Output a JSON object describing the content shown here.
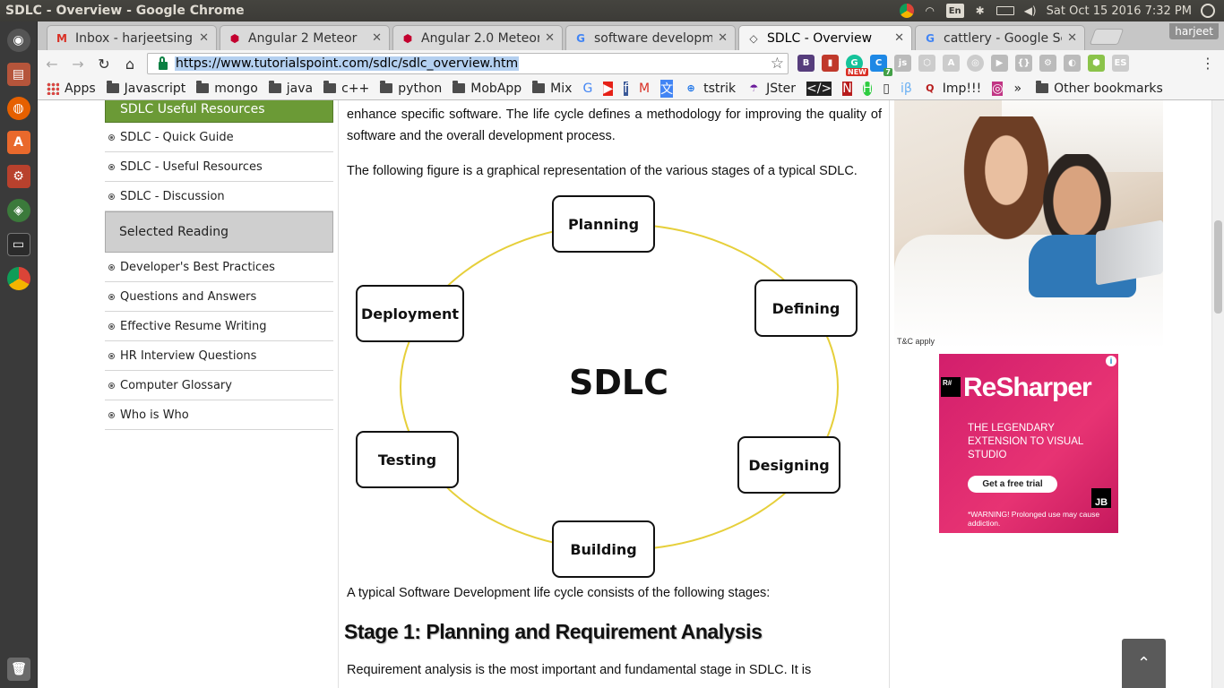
{
  "window": {
    "title": "SDLC - Overview - Google Chrome"
  },
  "tray": {
    "lang": "En",
    "datetime": "Sat Oct 15 2016  7:32 PM"
  },
  "launcher": {
    "items": [
      "dash-icon",
      "files-icon",
      "firefox-icon",
      "software-center-icon",
      "settings-icon",
      "android-studio-icon",
      "terminal-icon",
      "chrome-icon",
      "trash-icon"
    ]
  },
  "tabs": [
    {
      "title": "Inbox - harjeetsingh",
      "icon": "gmail-icon",
      "color": "#d93025"
    },
    {
      "title": "Angular 2 Meteor",
      "icon": "angular-icon",
      "color": "#c3002f"
    },
    {
      "title": "Angular 2.0 Meteor",
      "icon": "angular-icon",
      "color": "#c3002f"
    },
    {
      "title": "software developm",
      "icon": "google-icon",
      "color": "#4285f4"
    },
    {
      "title": "SDLC - Overview",
      "icon": "tutorialspoint-icon",
      "color": "#444444"
    },
    {
      "title": "cattlery - Google Se",
      "icon": "google-icon",
      "color": "#4285f4"
    }
  ],
  "profile": {
    "name": "harjeet"
  },
  "address_bar": {
    "url": "https://www.tutorialspoint.com/sdlc/sdlc_overview.htm"
  },
  "extensions": {
    "new_badge": "NEW",
    "count_badge": "7"
  },
  "bookmarks": {
    "apps": "Apps",
    "folders": [
      "Javascript",
      "mongo",
      "java",
      "c++",
      "python",
      "MobApp",
      "Mix"
    ],
    "links": [
      "tstrik",
      "JSter",
      "Imp!!!"
    ],
    "overflow": "»",
    "other": "Other bookmarks"
  },
  "sidebar": {
    "useful_heading": "SDLC Useful Resources",
    "useful_links": [
      "SDLC - Quick Guide",
      "SDLC - Useful Resources",
      "SDLC - Discussion"
    ],
    "reading_heading": "Selected Reading",
    "reading_links": [
      "Developer's Best Practices",
      "Questions and Answers",
      "Effective Resume Writing",
      "HR Interview Questions",
      "Computer Glossary",
      "Who is Who"
    ]
  },
  "content": {
    "para1": "enhance specific software. The life cycle defines a methodology for improving the quality of software and the overall development process.",
    "para2": "The following figure is a graphical representation of the various stages of a typical SDLC.",
    "diagram": {
      "center": "SDLC",
      "stages": [
        "Planning",
        "Defining",
        "Designing",
        "Building",
        "Testing",
        "Deployment"
      ]
    },
    "para3": "A typical Software Development life cycle consists of the following stages:",
    "stage1_heading": "Stage 1: Planning and Requirement Analysis",
    "para4": "Requirement analysis is the most important and fundamental stage in SDLC. It is"
  },
  "ads": {
    "photo_disclaimer": "T&C apply",
    "resharper": {
      "logo": "R#",
      "title": "ReSharper",
      "tagline": "THE LEGENDARY EXTENSION TO VISUAL STUDIO",
      "cta": "Get a free trial",
      "brand": "JB",
      "warning": "*WARNING! Prolonged use may cause addiction.",
      "adchoices": "i"
    }
  },
  "back_to_top": {
    "label": "⌃"
  }
}
